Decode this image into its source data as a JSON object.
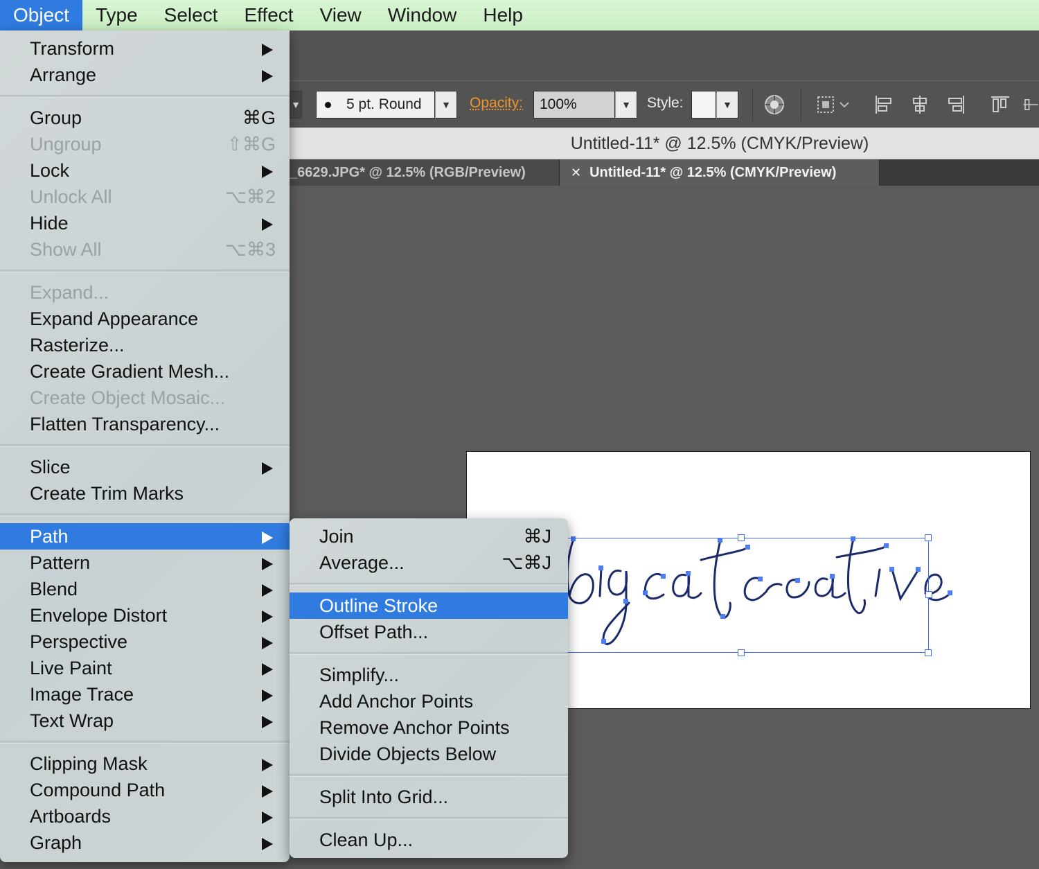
{
  "menubar": {
    "items": [
      "Object",
      "Type",
      "Select",
      "Effect",
      "View",
      "Window",
      "Help"
    ],
    "active": "Object"
  },
  "control_bar": {
    "stroke_profile": "5 pt. Round",
    "opacity_label": "Opacity:",
    "opacity_value": "100%",
    "style_label": "Style:"
  },
  "document": {
    "title": "Untitled-11* @ 12.5% (CMYK/Preview)",
    "tabs": [
      {
        "label": "_6629.JPG* @ 12.5% (RGB/Preview)",
        "active": false
      },
      {
        "label": "Untitled-11* @ 12.5% (CMYK/Preview)",
        "active": true,
        "close": "✕"
      }
    ],
    "artwork_text": "big cat creative"
  },
  "object_menu": {
    "groups": [
      [
        {
          "label": "Transform",
          "submenu": true
        },
        {
          "label": "Arrange",
          "submenu": true
        }
      ],
      [
        {
          "label": "Group",
          "shortcut": "⌘G"
        },
        {
          "label": "Ungroup",
          "shortcut": "⇧⌘G",
          "disabled": true
        },
        {
          "label": "Lock",
          "submenu": true
        },
        {
          "label": "Unlock All",
          "shortcut": "⌥⌘2",
          "disabled": true
        },
        {
          "label": "Hide",
          "submenu": true
        },
        {
          "label": "Show All",
          "shortcut": "⌥⌘3",
          "disabled": true
        }
      ],
      [
        {
          "label": "Expand...",
          "disabled": true
        },
        {
          "label": "Expand Appearance"
        },
        {
          "label": "Rasterize..."
        },
        {
          "label": "Create Gradient Mesh..."
        },
        {
          "label": "Create Object Mosaic...",
          "disabled": true
        },
        {
          "label": "Flatten Transparency..."
        }
      ],
      [
        {
          "label": "Slice",
          "submenu": true
        },
        {
          "label": "Create Trim Marks"
        }
      ],
      [
        {
          "label": "Path",
          "submenu": true,
          "highlighted": true
        },
        {
          "label": "Pattern",
          "submenu": true
        },
        {
          "label": "Blend",
          "submenu": true
        },
        {
          "label": "Envelope Distort",
          "submenu": true
        },
        {
          "label": "Perspective",
          "submenu": true
        },
        {
          "label": "Live Paint",
          "submenu": true
        },
        {
          "label": "Image Trace",
          "submenu": true
        },
        {
          "label": "Text Wrap",
          "submenu": true
        }
      ],
      [
        {
          "label": "Clipping Mask",
          "submenu": true
        },
        {
          "label": "Compound Path",
          "submenu": true
        },
        {
          "label": "Artboards",
          "submenu": true
        },
        {
          "label": "Graph",
          "submenu": true
        }
      ]
    ]
  },
  "path_submenu": {
    "groups": [
      [
        {
          "label": "Join",
          "shortcut": "⌘J"
        },
        {
          "label": "Average...",
          "shortcut": "⌥⌘J"
        }
      ],
      [
        {
          "label": "Outline Stroke",
          "highlighted": true
        },
        {
          "label": "Offset Path..."
        }
      ],
      [
        {
          "label": "Simplify..."
        },
        {
          "label": "Add Anchor Points"
        },
        {
          "label": "Remove Anchor Points"
        },
        {
          "label": "Divide Objects Below"
        }
      ],
      [
        {
          "label": "Split Into Grid..."
        }
      ],
      [
        {
          "label": "Clean Up..."
        }
      ]
    ]
  },
  "colors": {
    "highlight": "#2f7be0",
    "selection": "#3d6cf0",
    "menubar": "#cdefc7",
    "opacity_label": "#f0932a"
  }
}
